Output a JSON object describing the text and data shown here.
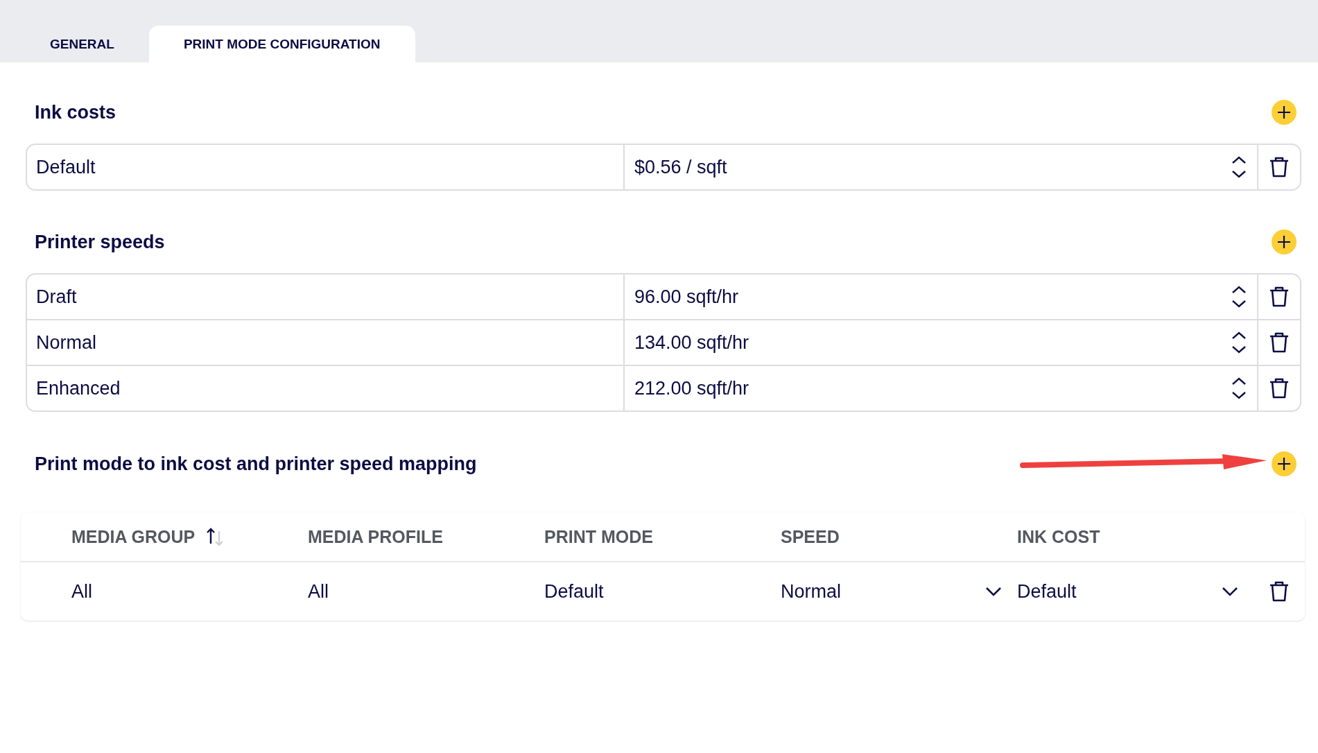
{
  "tabs": [
    {
      "label": "GENERAL",
      "selected": false
    },
    {
      "label": "PRINT MODE CONFIGURATION",
      "selected": true
    }
  ],
  "ink_costs": {
    "title": "Ink costs",
    "rows": [
      {
        "name": "Default",
        "value": "$0.56 / sqft"
      }
    ]
  },
  "printer_speeds": {
    "title": "Printer speeds",
    "rows": [
      {
        "name": "Draft",
        "value": "96.00 sqft/hr"
      },
      {
        "name": "Normal",
        "value": "134.00 sqft/hr"
      },
      {
        "name": "Enhanced",
        "value": "212.00 sqft/hr"
      }
    ]
  },
  "mapping": {
    "title": "Print mode to ink cost and printer speed mapping",
    "columns": [
      {
        "label": "MEDIA GROUP",
        "sorted": true,
        "sort_ascending": true
      },
      {
        "label": "MEDIA PROFILE",
        "sorted": false
      },
      {
        "label": "PRINT MODE",
        "sorted": false
      },
      {
        "label": "SPEED",
        "sorted": false
      },
      {
        "label": "INK COST",
        "sorted": false
      }
    ],
    "rows": [
      {
        "cells": [
          {
            "kind": "text",
            "value": "All"
          },
          {
            "kind": "text",
            "value": "All"
          },
          {
            "kind": "text",
            "value": "Default"
          },
          {
            "kind": "select",
            "value": "Normal"
          },
          {
            "kind": "select",
            "value": "Default"
          }
        ]
      }
    ]
  }
}
